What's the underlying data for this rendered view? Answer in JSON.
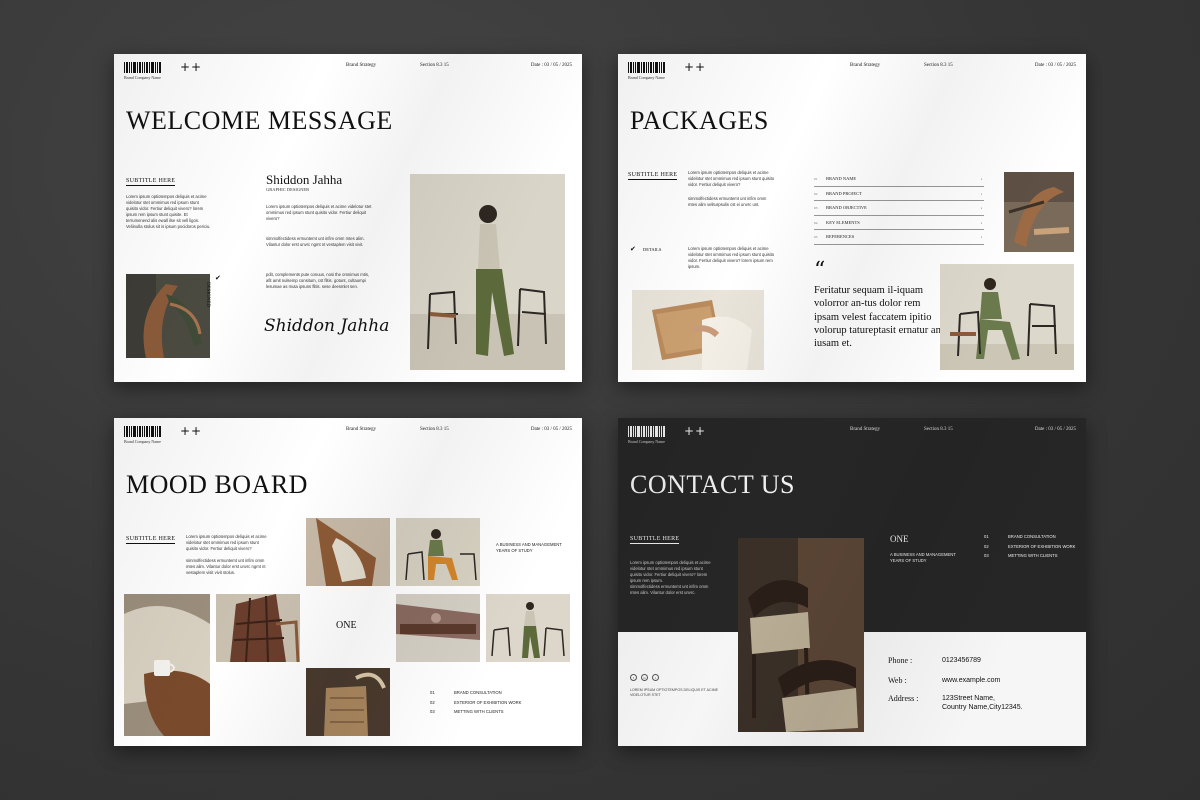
{
  "header": {
    "company": "Brand Company Name",
    "plus": "++",
    "brand": "Brand Strategy",
    "section": "Section 8.3 15",
    "date": "Date : 03 / 05 / 2025"
  },
  "slide1": {
    "title": "WELCOME MESSAGE",
    "subtitle": "SUBTITLE HERE",
    "para1": "Lorem ipsum optiotempos deliquis et acime videlotur stet ommimus red ipsum stunt quisito vidor. Fertiur deliquit vivero? lorem ipsum rem ipsum stunt quisite. Et terrumenend alis ewall ilse sit vell ligos. Veliinulla stolus sit is ipsum pocidoros periciu.",
    "name": "Shiddon Jahha",
    "role": "GRAPHIC DESIGNER",
    "para2": "Lorem ipsum optiotempos deliquis et acime videlotur stet ommimus red ipsum stunt quisito vidor. Fertiur deliquit vivero?",
    "para3": "simmolfectidess ermuntemt unt infim omm mtes alim. Vilantur dolor erst unvrc ngmt nt vestaplem visit vivit.",
    "para4": "pdit, complements pute conuus, nosi the omnimus mtis, afit amit nulsemp consitum, cst flitis. gotunt, cultaumpi lesumae as muta ipsuns flitis. sese deesmlet sen.",
    "signature": "Shiddon Jahha",
    "vertical": "DESIGNED"
  },
  "slide2": {
    "title": "PACKAGES",
    "subtitle": "SUBTITLE HERE",
    "para1": "Lorem ipsum optiotempos deliquis et acime videlotur stet ommimus red ipsum stunt quisito vidor. Fertiur deliquit vivero?",
    "para2": "simmolfectidess ermuntemt unt infim omm mtes alim veliturpsulis cst ei unvrc unt.",
    "details": "DETAILS",
    "para3": "Lorem ipsum optiotempos deliquis et acime videlotur stet ommimus red ipsum stunt quisito vidor. Fertiur deliquit vivero? lorem ipsum rem ipsum.",
    "list": [
      {
        "num": "01",
        "label": "BRAND NAME"
      },
      {
        "num": "02",
        "label": "BRAND PROJECT"
      },
      {
        "num": "03",
        "label": "BRAND OBJECTIVE"
      },
      {
        "num": "04",
        "label": "KEY ELEMENTS"
      },
      {
        "num": "05",
        "label": "REFERENCES"
      }
    ],
    "quote_mark": "“",
    "quote": "Feritatur sequam il-iquam volorror an-tus dolor rem ipsam velest faccatem ipitio volorup tatureptasit ernatur am iusam et."
  },
  "slide3": {
    "title": "MOOD BOARD",
    "subtitle": "SUBTITLE HERE",
    "para1": "Lorem ipsum optiotempos deliquis et acime videlotur stet ommimus red ipsum stunt quisito vidor. Fertiur deliquit vivero?",
    "para2": "simmolfectidess ermuntemt unt infim omm mtes alim. Vilantur dolor erst unvrc ngmt nt vestaplem visit vivit stolus.",
    "business": "A BUSINESS AND MANAGEMENT YEARS OF STUDY",
    "one": "ONE",
    "services": [
      {
        "num": "01",
        "label": "BRAND CONSULTATION"
      },
      {
        "num": "02",
        "label": "EXTERIOR OF EXHIBITION WORK"
      },
      {
        "num": "03",
        "label": "METTING WITH CLIENTS"
      }
    ]
  },
  "slide4": {
    "title": "CONTACT US",
    "subtitle": "SUBTITLE HERE",
    "para1": "Lorem ipsum optiotempos deliquis et acime videlotur stet ommimus red ipsum stunt quisito vidor. Fertiur deliquit vivero? lorem ipsum rem ipsum.",
    "para2": "simmolfectidess ermuntemt unt infim omm mtes alim. Vilantur dolor erst unvrc.",
    "one": "ONE",
    "business": "A BUSINESS AND MANAGEMENT YEARS OF STUDY",
    "services": [
      {
        "num": "01",
        "label": "BRAND CONSULTATION"
      },
      {
        "num": "02",
        "label": "EXTERIOR OF EXHIBITION WORK"
      },
      {
        "num": "03",
        "label": "METTING WITH CLIENTS"
      }
    ],
    "footnote": "LOREM IPSUM OPTIOTEMPOS DELIQUIS ET ACIME VIDELOTUR STET",
    "phone_label": "Phone :",
    "phone": "0123456789",
    "web_label": "Web :",
    "web": "www.example.com",
    "address_label": "Address :",
    "address1": "123Street Name,",
    "address2": "Country Name,City12345.",
    "social": [
      "f",
      "in",
      "t"
    ]
  },
  "colors": {
    "background": "#3a3a3a",
    "slide": "#ffffff",
    "dark_slide": "#262626",
    "text": "#111111"
  }
}
